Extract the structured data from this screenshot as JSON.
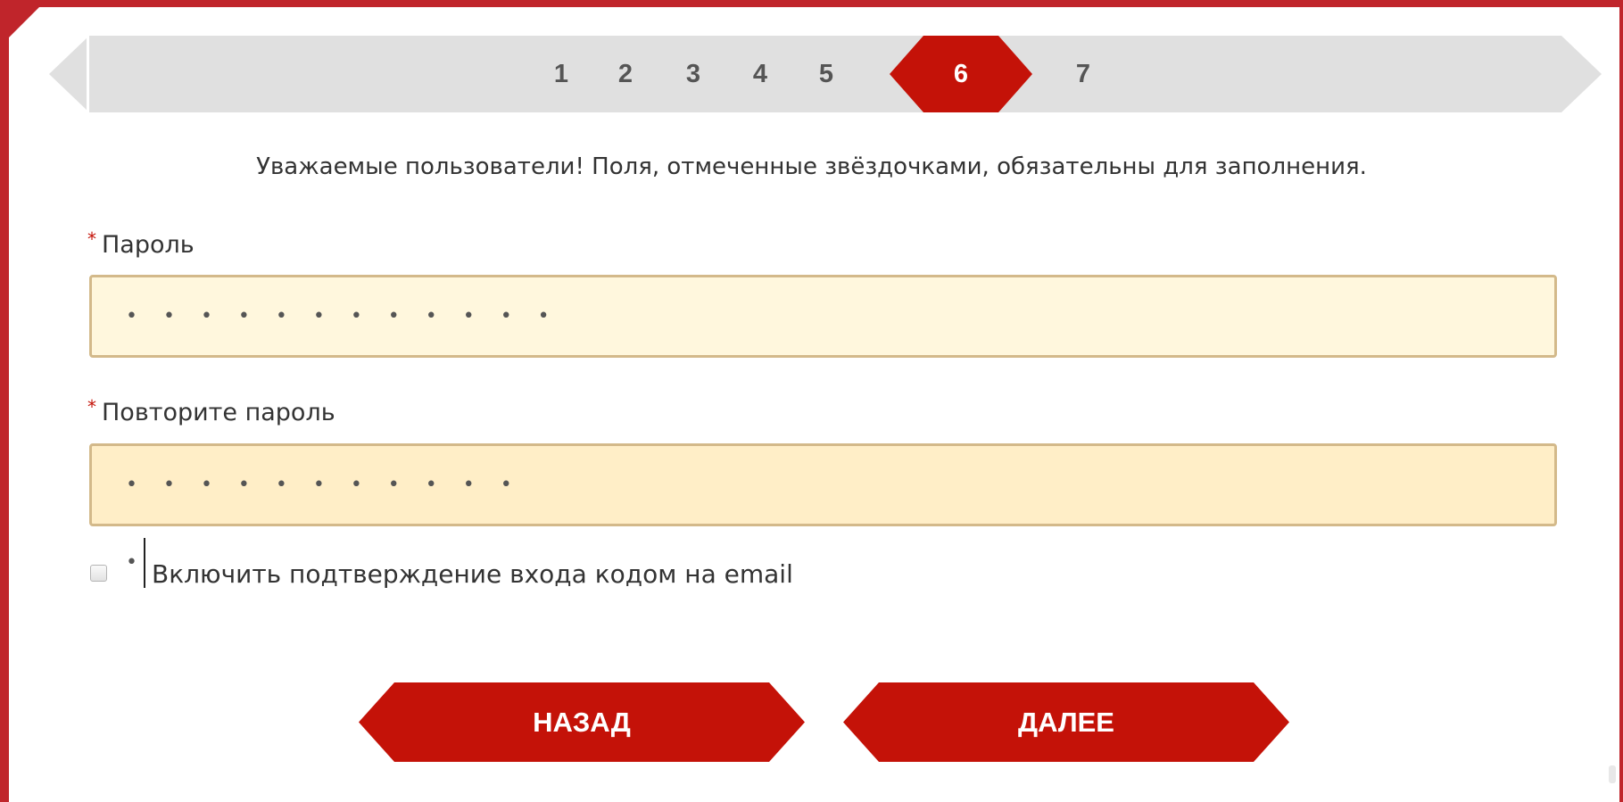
{
  "steps": {
    "items": [
      "1",
      "2",
      "3",
      "4",
      "5",
      "6",
      "7"
    ],
    "active": "6"
  },
  "notice": "Уважаемые пользователи! Поля, отмеченные звёздочками, обязательны для заполнения.",
  "form": {
    "required_mark": "*",
    "password": {
      "label": "Пароль",
      "value": "• • • • • • • • • • • •"
    },
    "repeat_password": {
      "label": "Повторите пароль",
      "value": "• • • • • • • • • • • •"
    },
    "email_confirm": {
      "label": "Включить подтверждение входа кодом на email",
      "checked": false
    }
  },
  "buttons": {
    "back": "НАЗАД",
    "next": "ДАЛЕЕ"
  },
  "colors": {
    "accent": "#c41208",
    "frame": "#c0252b",
    "field_bg": "#fff7dd",
    "field_bg_focused": "#ffeec7",
    "field_border": "#d3b98a",
    "stepbar_bg": "#e0e0e0"
  }
}
